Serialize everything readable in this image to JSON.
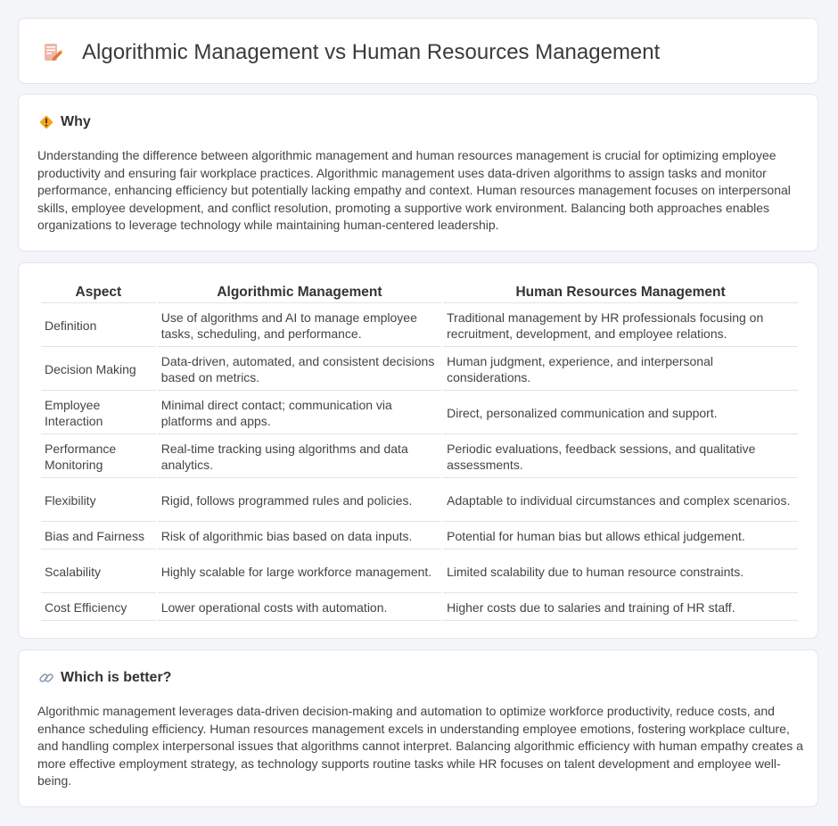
{
  "header": {
    "title": "Algorithmic Management vs Human Resources Management",
    "icon": "document-pencil-icon"
  },
  "why": {
    "heading": "Why",
    "icon": "diamond-sign-icon",
    "body": "Understanding the difference between algorithmic management and human resources management is crucial for optimizing employee productivity and ensuring fair workplace practices. Algorithmic management uses data-driven algorithms to assign tasks and monitor performance, enhancing efficiency but potentially lacking empathy and context. Human resources management focuses on interpersonal skills, employee development, and conflict resolution, promoting a supportive work environment. Balancing both approaches enables organizations to leverage technology while maintaining human-centered leadership."
  },
  "table": {
    "headers": [
      "Aspect",
      "Algorithmic Management",
      "Human Resources Management"
    ],
    "rows": [
      {
        "aspect": "Definition",
        "algorithmic": "Use of algorithms and AI to manage employee tasks, scheduling, and performance.",
        "hr": "Traditional management by HR professionals focusing on recruitment, development, and employee relations."
      },
      {
        "aspect": "Decision Making",
        "algorithmic": "Data-driven, automated, and consistent decisions based on metrics.",
        "hr": "Human judgment, experience, and interpersonal considerations."
      },
      {
        "aspect": "Employee Interaction",
        "algorithmic": "Minimal direct contact; communication via platforms and apps.",
        "hr": "Direct, personalized communication and support."
      },
      {
        "aspect": "Performance Monitoring",
        "algorithmic": "Real-time tracking using algorithms and data analytics.",
        "hr": "Periodic evaluations, feedback sessions, and qualitative assessments."
      },
      {
        "aspect": "Flexibility",
        "algorithmic": "Rigid, follows programmed rules and policies.",
        "hr": "Adaptable to individual circumstances and complex scenarios."
      },
      {
        "aspect": "Bias and Fairness",
        "algorithmic": "Risk of algorithmic bias based on data inputs.",
        "hr": "Potential for human bias but allows ethical judgement."
      },
      {
        "aspect": "Scalability",
        "algorithmic": "Highly scalable for large workforce management.",
        "hr": "Limited scalability due to human resource constraints."
      },
      {
        "aspect": "Cost Efficiency",
        "algorithmic": "Lower operational costs with automation.",
        "hr": "Higher costs due to salaries and training of HR staff."
      }
    ]
  },
  "better": {
    "heading": "Which is better?",
    "icon": "link-icon",
    "body": "Algorithmic management leverages data-driven decision-making and automation to optimize workforce productivity, reduce costs, and enhance scheduling efficiency. Human resources management excels in understanding employee emotions, fostering workplace culture, and handling complex interpersonal issues that algorithms cannot interpret. Balancing algorithmic efficiency with human empathy creates a more effective employment strategy, as technology supports routine tasks while HR focuses on talent development and employee well-being."
  }
}
